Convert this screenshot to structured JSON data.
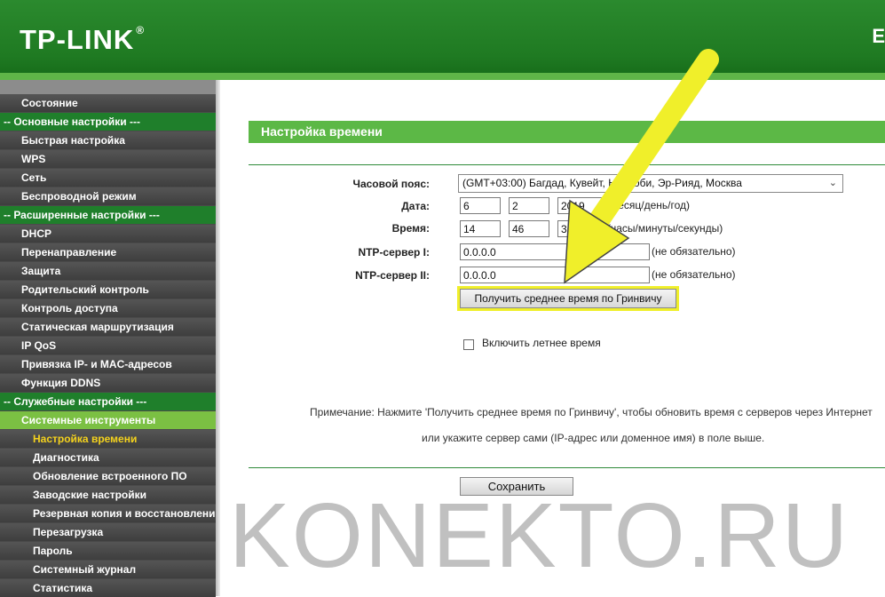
{
  "header": {
    "logo": "TP-LINK",
    "logo_mark": "®",
    "right_text": "E"
  },
  "sidebar": {
    "items": [
      {
        "label": "Состояние",
        "kind": "item"
      },
      {
        "label": "-- Основные настройки ---",
        "kind": "section"
      },
      {
        "label": "Быстрая настройка",
        "kind": "item"
      },
      {
        "label": "WPS",
        "kind": "item"
      },
      {
        "label": "Сеть",
        "kind": "item"
      },
      {
        "label": "Беспроводной режим",
        "kind": "item"
      },
      {
        "label": "-- Расширенные настройки ---",
        "kind": "section"
      },
      {
        "label": "DHCP",
        "kind": "item"
      },
      {
        "label": "Перенаправление",
        "kind": "item"
      },
      {
        "label": "Защита",
        "kind": "item"
      },
      {
        "label": "Родительский контроль",
        "kind": "item"
      },
      {
        "label": "Контроль доступа",
        "kind": "item"
      },
      {
        "label": "Статическая маршрутизация",
        "kind": "item"
      },
      {
        "label": "IP QoS",
        "kind": "item"
      },
      {
        "label": "Привязка IP- и MAC-адресов",
        "kind": "item"
      },
      {
        "label": "Функция DDNS",
        "kind": "item"
      },
      {
        "label": "-- Служебные настройки ---",
        "kind": "section"
      },
      {
        "label": "Системные инструменты",
        "kind": "active-parent"
      },
      {
        "label": "Настройка времени",
        "kind": "sub-current"
      },
      {
        "label": "Диагностика",
        "kind": "sub"
      },
      {
        "label": "Обновление встроенного ПО",
        "kind": "sub"
      },
      {
        "label": "Заводские настройки",
        "kind": "sub"
      },
      {
        "label": "Резервная копия и восстановление",
        "kind": "sub"
      },
      {
        "label": "Перезагрузка",
        "kind": "sub"
      },
      {
        "label": "Пароль",
        "kind": "sub"
      },
      {
        "label": "Системный журнал",
        "kind": "sub"
      },
      {
        "label": "Статистика",
        "kind": "sub"
      }
    ]
  },
  "main": {
    "title": "Настройка времени",
    "timezone": {
      "label": "Часовой пояс:",
      "value": "(GMT+03:00) Багдад, Кувейт, Найроби, Эр-Рияд, Москва"
    },
    "date": {
      "label": "Дата:",
      "month": "6",
      "day": "2",
      "year": "2019",
      "hint": "(месяц/день/год)"
    },
    "time": {
      "label": "Время:",
      "hours": "14",
      "minutes": "46",
      "seconds": "35",
      "hint": "(часы/минуты/секунды)"
    },
    "ntp1": {
      "label": "NTP-сервер I:",
      "value": "0.0.0.0",
      "hint": "(не обязательно)"
    },
    "ntp2": {
      "label": "NTP-сервер II:",
      "value": "0.0.0.0",
      "hint": "(не обязательно)"
    },
    "gmt_button": "Получить среднее время по Гринвичу",
    "dst_label": "Включить летнее время",
    "note_line1": "Примечание: Нажмите 'Получить среднее время по Гринвичу', чтобы обновить время с серверов через Интернет",
    "note_line2": "или укажите сервер сами (IP-адрес или доменное имя) в поле выше.",
    "save_button": "Сохранить"
  },
  "watermark": "KONEKTO.RU",
  "colors": {
    "header_green": "#1f7a22",
    "section_green": "#1f7f2b",
    "active_green": "#7bc043",
    "title_green": "#5cb846",
    "arrow_yellow": "#f0ef2a"
  }
}
